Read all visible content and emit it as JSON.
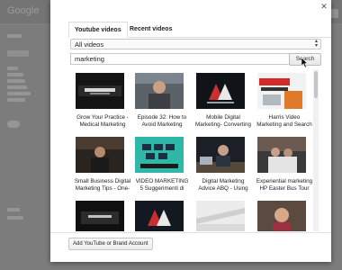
{
  "background_app": {
    "logo_text": "Google"
  },
  "dialog": {
    "tabs": [
      {
        "label": "Youtube videos"
      },
      {
        "label": "Recent videos"
      }
    ],
    "filter": {
      "selected": "All videos"
    },
    "search": {
      "value": "marketing",
      "button_label": "Search"
    },
    "videos": [
      {
        "title_line1": "Grow Your Practice -",
        "title_line2": "Medical Marketing"
      },
      {
        "title_line1": "Episode 32: How to",
        "title_line2": "Avoid Marketing"
      },
      {
        "title_line1": "Mobile Digital",
        "title_line2": "Marketing- Converting"
      },
      {
        "title_line1": "Harris Video",
        "title_line2": "Marketing and Search"
      },
      {
        "title_line1": "Small Business Digital",
        "title_line2": "Marketing Tips - One-"
      },
      {
        "title_line1": "VIDEO MARKETING",
        "title_line2": "5 Suggerimenti di"
      },
      {
        "title_line1": "Digital Marketing",
        "title_line2": "Advice ABQ - Using"
      },
      {
        "title_line1": "Experiential marketing",
        "title_line2": "HP Easter Bus Tour"
      },
      {
        "title_line1": "",
        "title_line2": ""
      },
      {
        "title_line1": "",
        "title_line2": ""
      },
      {
        "title_line1": "",
        "title_line2": ""
      },
      {
        "title_line1": "",
        "title_line2": ""
      }
    ],
    "footer": {
      "add_account_label": "Add YouTube or Brand Account"
    }
  }
}
